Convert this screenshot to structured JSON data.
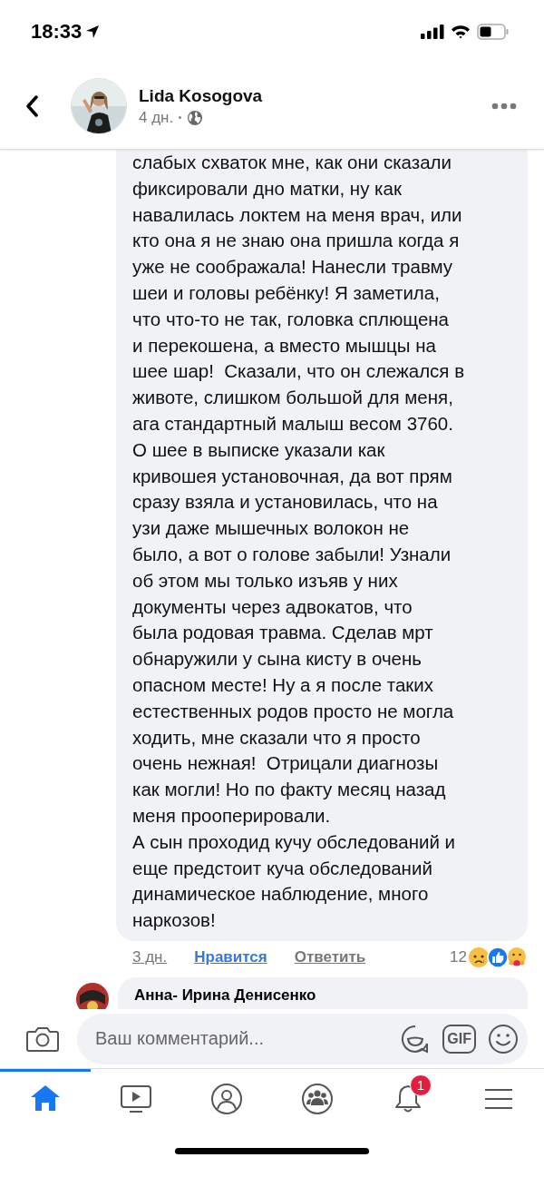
{
  "status_bar": {
    "time": "18:33"
  },
  "header": {
    "author": "Lida Kosogova",
    "time": "4 дн."
  },
  "comment": {
    "text": "слабых схваток мне, как они сказали\nфиксировали дно матки, ну как\nнавалилась локтем на меня врач, или\nкто она я не знаю она пришла когда я\nуже не соображала! Нанесли травму\nшеи и головы ребёнку! Я заметила,\nчто что-то не так, головка сплющена\nи перекошена, а вместо мышцы на\nшее шар!  Сказали, что он слежался в\nживоте, слишком большой для меня,\nага стандартный малыш весом 3760.\nО шее в выписке указали как\nкривошея установочная, да вот прям\nсразу взяла и установилась, что на\nузи даже мышечных волокон не\nбыло, а вот о голове забыли! Узнали\nоб этом мы только изъяв у них\nдокументы через адвокатов, что\nбыла родовая травма. Сделав мрт\nобнаружили у сына кисту в очень\nопасном месте! Ну а я после таких\nестественных родов просто не могла\nходить, мне сказали что я просто\nочень нежная!  Отрицали диагнозы\nкак могли! Но по факту месяц назад\nменя прооперировали.\nА сын проходид кучу обследований и\nеще предстоит куча обследований\nдинамическое наблюдение, много\nнаркозов!",
    "time": "3 дн.",
    "like": "Нравится",
    "liked": true,
    "reply": "Ответить",
    "reaction_count": "12"
  },
  "next_comment": {
    "author": "Анна- Ирина Денисенко"
  },
  "composer": {
    "placeholder": "Ваш комментарий...",
    "gif": "GIF"
  },
  "tabs": [
    {
      "kind": "home",
      "selected": true
    },
    {
      "kind": "video",
      "selected": false
    },
    {
      "kind": "profile",
      "selected": false
    },
    {
      "kind": "groups",
      "selected": false
    },
    {
      "kind": "notifications",
      "selected": false,
      "badge": "1"
    },
    {
      "kind": "menu",
      "selected": false
    }
  ]
}
